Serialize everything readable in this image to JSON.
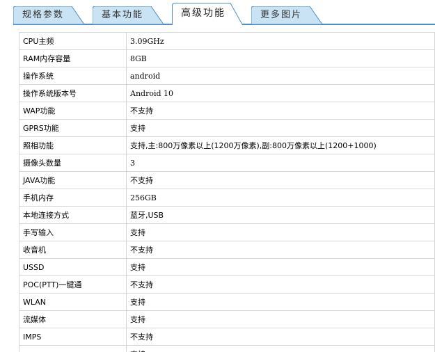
{
  "tabs": [
    {
      "label": "规格参数",
      "active": false
    },
    {
      "label": "基本功能",
      "active": false
    },
    {
      "label": "高级功能",
      "active": true
    },
    {
      "label": "更多图片",
      "active": false
    }
  ],
  "colors": {
    "tab_fill": "#c9e2f4",
    "tab_border": "#4f8dc7",
    "active_tab_fill": "#ffffff",
    "table_border": "#d6d6d6"
  },
  "specs": [
    {
      "key": "CPU主频",
      "value": "3.09GHz"
    },
    {
      "key": "RAM内存容量",
      "value": "8GB"
    },
    {
      "key": "操作系统",
      "value": "android"
    },
    {
      "key": "操作系统版本号",
      "value": "Android 10"
    },
    {
      "key": "WAP功能",
      "value": "不支持"
    },
    {
      "key": "GPRS功能",
      "value": "支持"
    },
    {
      "key": "照相功能",
      "value": "支持,主:800万像素以上(1200万像素),副:800万像素以上(1200+1000)"
    },
    {
      "key": "摄像头数量",
      "value": "3"
    },
    {
      "key": "JAVA功能",
      "value": "不支持"
    },
    {
      "key": "手机内存",
      "value": "256GB"
    },
    {
      "key": "本地连接方式",
      "value": "蓝牙,USB"
    },
    {
      "key": "手写输入",
      "value": "支持"
    },
    {
      "key": "收音机",
      "value": "不支持"
    },
    {
      "key": "USSD",
      "value": "支持"
    },
    {
      "key": "POC(PTT)一键通",
      "value": "不支持"
    },
    {
      "key": "WLAN",
      "value": "支持"
    },
    {
      "key": "流媒体",
      "value": "支持"
    },
    {
      "key": "IMPS",
      "value": "不支持"
    },
    {
      "key": "",
      "value": "支持"
    }
  ]
}
